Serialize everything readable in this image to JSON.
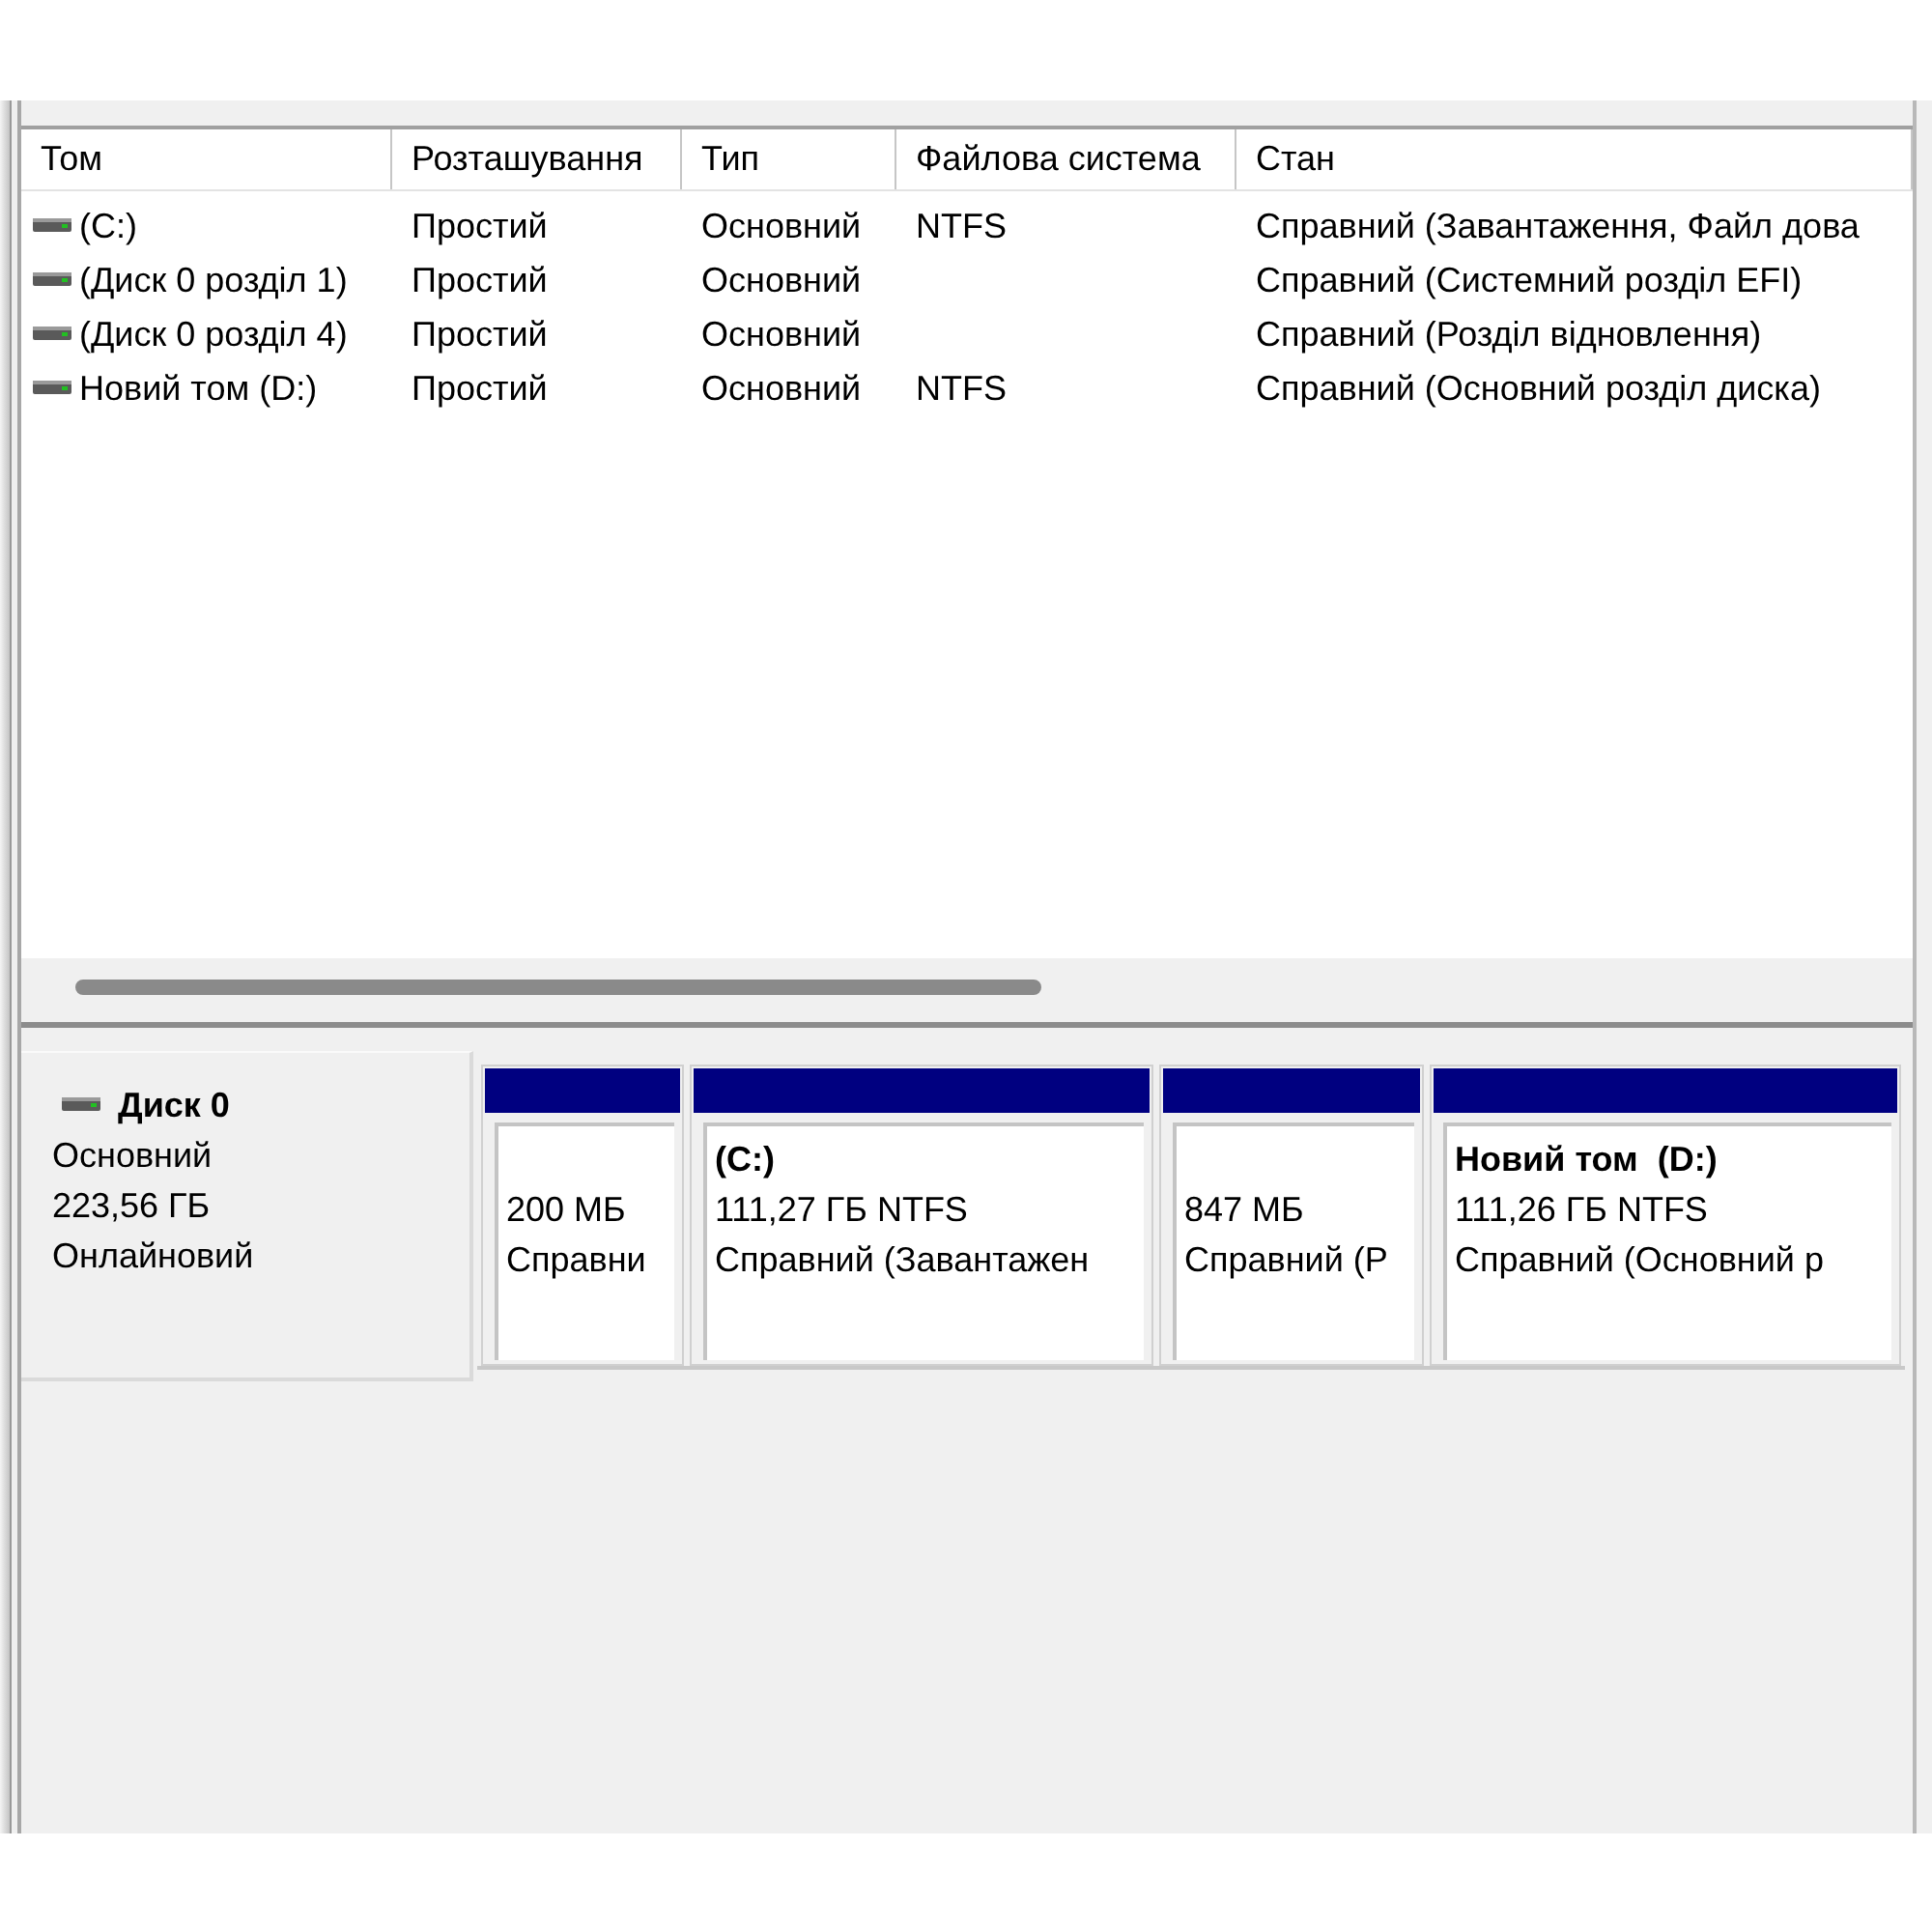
{
  "volume_list": {
    "columns": [
      "Том",
      "Розташування",
      "Тип",
      "Файлова система",
      "Стан"
    ],
    "rows": [
      {
        "volume": "(C:)",
        "layout": "Простий",
        "type": "Основний",
        "file_system": "NTFS",
        "status": "Справний (Завантаження, Файл дова"
      },
      {
        "volume": "(Диск 0 розділ 1)",
        "layout": "Простий",
        "type": "Основний",
        "status": "Справний (Системний розділ EFI)"
      },
      {
        "volume": "(Диск 0 розділ 4)",
        "layout": "Простий",
        "type": "Основний",
        "status": "Справний (Розділ відновлення)"
      },
      {
        "volume": "Новий том (D:)",
        "layout": "Простий",
        "type": "Основний",
        "file_system": "NTFS",
        "status": "Справний (Основний розділ диска)"
      }
    ]
  },
  "disks": [
    {
      "name": "Диск 0",
      "type": "Основний",
      "size": "223,56 ГБ",
      "status": "Онлайновий",
      "partitions": [
        {
          "size": "200 МБ",
          "status": "Справни"
        },
        {
          "label": "(C:)",
          "size": "111,27 ГБ NTFS",
          "status": "Справний (Завантажен"
        },
        {
          "size": "847 МБ",
          "status": "Справний (Р"
        },
        {
          "label": "Новий том  (D:)",
          "size": "111,26 ГБ NTFS",
          "status": "Справний (Основний р"
        }
      ]
    }
  ]
}
